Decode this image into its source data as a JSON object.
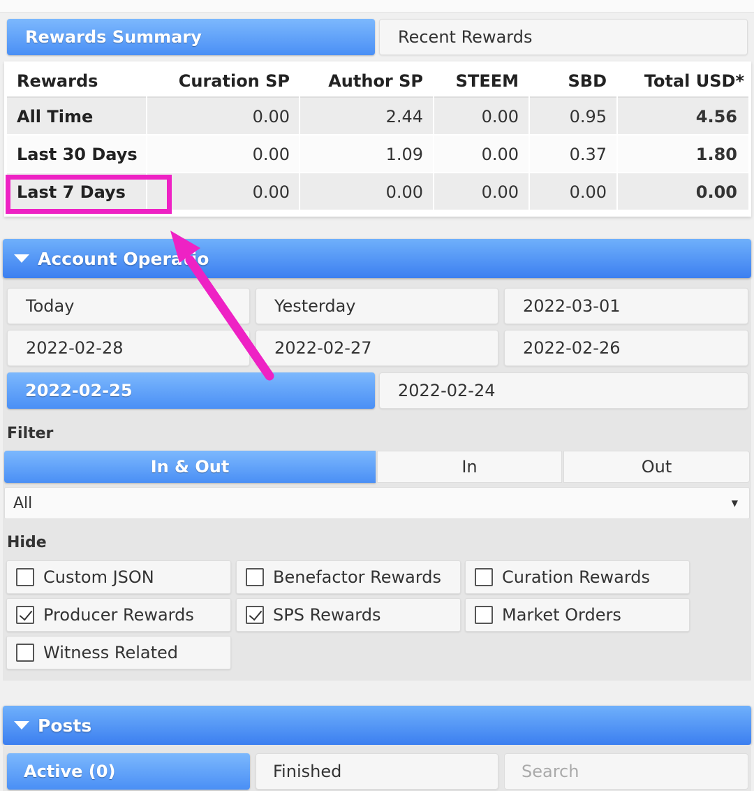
{
  "tabs": {
    "rewards_summary": "Rewards Summary",
    "recent_rewards": "Recent Rewards"
  },
  "rewards_table": {
    "headers": [
      "Rewards",
      "Curation SP",
      "Author SP",
      "STEEM",
      "SBD",
      "Total USD*"
    ],
    "rows": [
      {
        "label": "All Time",
        "curation_sp": "0.00",
        "author_sp": "2.44",
        "steem": "0.00",
        "sbd": "0.95",
        "total_usd": "4.56"
      },
      {
        "label": "Last 30 Days",
        "curation_sp": "0.00",
        "author_sp": "1.09",
        "steem": "0.00",
        "sbd": "0.37",
        "total_usd": "1.80"
      },
      {
        "label": "Last 7 Days",
        "curation_sp": "0.00",
        "author_sp": "0.00",
        "steem": "0.00",
        "sbd": "0.00",
        "total_usd": "0.00"
      }
    ]
  },
  "account_operations": {
    "title": "Account Operatio",
    "dates": [
      "Today",
      "Yesterday",
      "2022-03-01",
      "2022-02-28",
      "2022-02-27",
      "2022-02-26",
      "2022-02-25",
      "2022-02-24"
    ],
    "selected_date": "2022-02-25",
    "filter_label": "Filter",
    "filter_options": [
      "In & Out",
      "In",
      "Out"
    ],
    "selected_filter": "In & Out",
    "type_select": "All",
    "hide_label": "Hide",
    "hide_options": [
      {
        "label": "Custom JSON",
        "checked": false
      },
      {
        "label": "Benefactor Rewards",
        "checked": false
      },
      {
        "label": "Curation Rewards",
        "checked": false
      },
      {
        "label": "Producer Rewards",
        "checked": true
      },
      {
        "label": "SPS Rewards",
        "checked": true
      },
      {
        "label": "Market Orders",
        "checked": false
      },
      {
        "label": "Witness Related",
        "checked": false
      }
    ]
  },
  "posts": {
    "title": "Posts",
    "tabs": [
      "Active (0)",
      "Finished"
    ],
    "search_placeholder": "Search"
  },
  "colors": {
    "accent_blue": "#4a8ff5",
    "annotation_magenta": "#ee22c4"
  }
}
